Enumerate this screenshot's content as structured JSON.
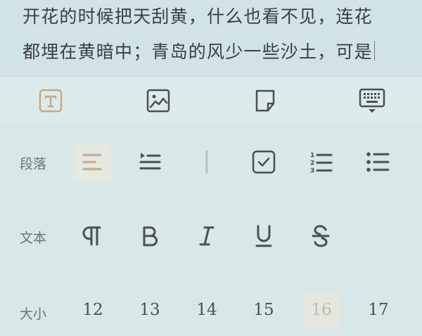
{
  "editor": {
    "line1": "开花的时候把天刮黄，什么也看不见，连花",
    "line2": "都埋在黄暗中；青岛的风少一些沙土，可是"
  },
  "toolbar": {
    "items": [
      {
        "icon": "text-format-icon",
        "active": true
      },
      {
        "icon": "image-icon",
        "active": false
      },
      {
        "icon": "sticky-note-icon",
        "active": false
      },
      {
        "icon": "keyboard-hide-icon",
        "active": false
      }
    ],
    "accent_color": "#c4a98b"
  },
  "paragraph": {
    "label": "段落",
    "items": [
      "align-left-icon",
      "indent-icon",
      "divider",
      "checkbox-icon",
      "numbered-list-icon",
      "bullet-list-icon"
    ],
    "active": "align-left-icon"
  },
  "text": {
    "label": "文本",
    "items": [
      "paragraph-mark-icon",
      "bold-icon",
      "italic-icon",
      "underline-icon",
      "strikethrough-icon"
    ]
  },
  "size": {
    "label": "大小",
    "values": [
      "12",
      "13",
      "14",
      "15",
      "16",
      "17"
    ],
    "selected": "16"
  }
}
